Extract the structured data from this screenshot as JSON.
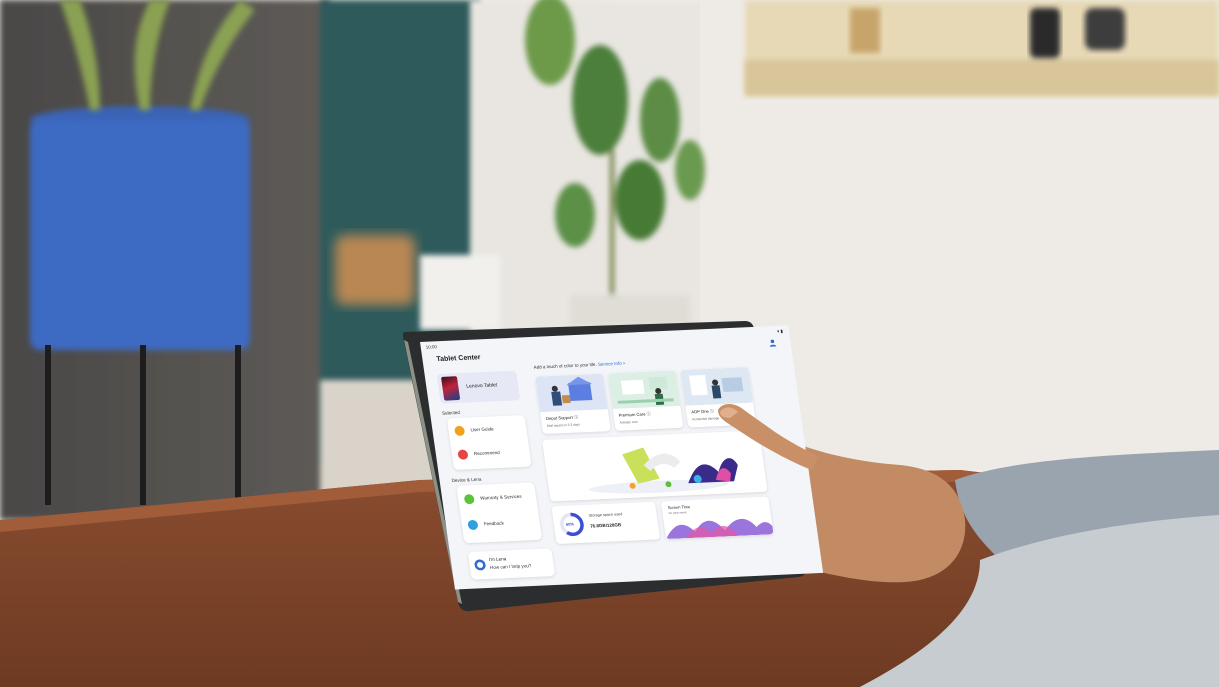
{
  "status_bar": {
    "time": "10:00",
    "icons": "▾ ▮"
  },
  "app": {
    "title": "Tablet Center",
    "profile_icon": "person-icon",
    "device": {
      "name": "Lenovo Tablet"
    },
    "selected": {
      "label": "Selected",
      "items": [
        {
          "label": "User Guide",
          "icon": "book-icon",
          "color": "#f0a21a"
        },
        {
          "label": "Recommend",
          "icon": "heart-icon",
          "color": "#e64646"
        }
      ]
    },
    "device_lena": {
      "label": "Device & Lena",
      "items": [
        {
          "label": "Warranty & Services",
          "icon": "wrench-icon",
          "color": "#5cc23a"
        },
        {
          "label": "Feedback",
          "icon": "feedback-icon",
          "color": "#2f9fe0"
        }
      ]
    },
    "lena": {
      "line1": "I'm Lena",
      "line2": "How can I help you?",
      "icon": "lena-avatar-icon"
    },
    "promo": {
      "text": "Add a touch of color to your life.",
      "link": "Service Info >"
    },
    "services": [
      {
        "title": "Depot Support ⓘ",
        "subtitle": "Mail repairs in 2-3 days"
      },
      {
        "title": "Premium Care ⓘ",
        "subtitle": "Activate now"
      },
      {
        "title": "ADP One ⓘ",
        "subtitle": "Accidental damage"
      }
    ],
    "storage": {
      "label": "Storage space used",
      "value": "76.8GB/128GB",
      "percent_text": "60%",
      "fraction": 0.6
    },
    "screen_time": {
      "label": "Screen Time",
      "subtitle": "So past week"
    }
  }
}
